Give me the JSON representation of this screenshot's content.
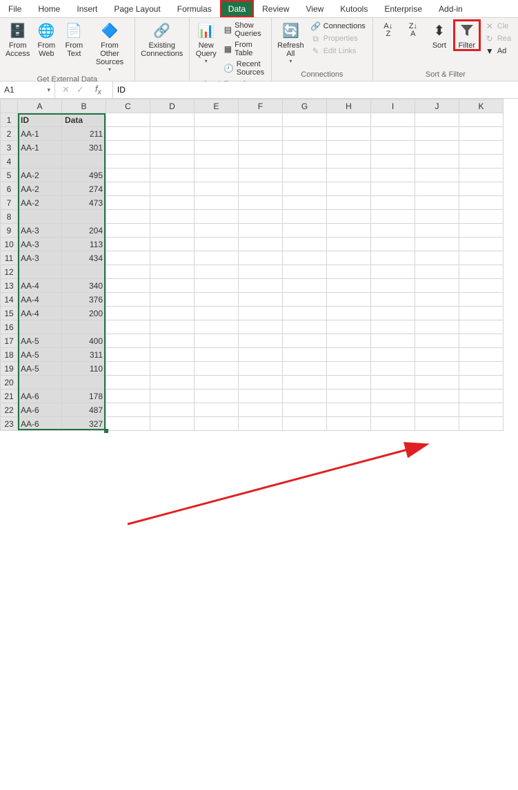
{
  "tabs": [
    "File",
    "Home",
    "Insert",
    "Page Layout",
    "Formulas",
    "Data",
    "Review",
    "View",
    "Kutools",
    "Enterprise",
    "Add-in"
  ],
  "active_tab": "Data",
  "ribbon": {
    "ext": {
      "label": "Get External Data",
      "from_access": "From\nAccess",
      "from_web": "From\nWeb",
      "from_text": "From\nText",
      "from_other": "From Other\nSources"
    },
    "existing": {
      "label": "Existing\nConnections"
    },
    "transform": {
      "label": "Get & Transform",
      "new_query": "New\nQuery",
      "show_queries": "Show Queries",
      "from_table": "From Table",
      "recent": "Recent Sources"
    },
    "conn": {
      "label": "Connections",
      "refresh": "Refresh\nAll",
      "connections": "Connections",
      "properties": "Properties",
      "edit_links": "Edit Links"
    },
    "sortfilter": {
      "label": "Sort & Filter",
      "sort": "Sort",
      "filter": "Filter",
      "clear": "Cle",
      "reapply": "Rea",
      "advanced": "Ad"
    }
  },
  "namebox": "A1",
  "formula": "ID",
  "columns": [
    "A",
    "B",
    "C",
    "D",
    "E",
    "F",
    "G",
    "H",
    "I",
    "J",
    "K"
  ],
  "rows": 23,
  "data": {
    "1": [
      "ID",
      "Data"
    ],
    "2": [
      "AA-1",
      "211"
    ],
    "3": [
      "AA-1",
      "301"
    ],
    "4": [
      "",
      ""
    ],
    "5": [
      "AA-2",
      "495"
    ],
    "6": [
      "AA-2",
      "274"
    ],
    "7": [
      "AA-2",
      "473"
    ],
    "8": [
      "",
      ""
    ],
    "9": [
      "AA-3",
      "204"
    ],
    "10": [
      "AA-3",
      "113"
    ],
    "11": [
      "AA-3",
      "434"
    ],
    "12": [
      "",
      ""
    ],
    "13": [
      "AA-4",
      "340"
    ],
    "14": [
      "AA-4",
      "376"
    ],
    "15": [
      "AA-4",
      "200"
    ],
    "16": [
      "",
      ""
    ],
    "17": [
      "AA-5",
      "400"
    ],
    "18": [
      "AA-5",
      "311"
    ],
    "19": [
      "AA-5",
      "110"
    ],
    "20": [
      "",
      ""
    ],
    "21": [
      "AA-6",
      "178"
    ],
    "22": [
      "AA-6",
      "487"
    ],
    "23": [
      "AA-6",
      "327"
    ]
  }
}
